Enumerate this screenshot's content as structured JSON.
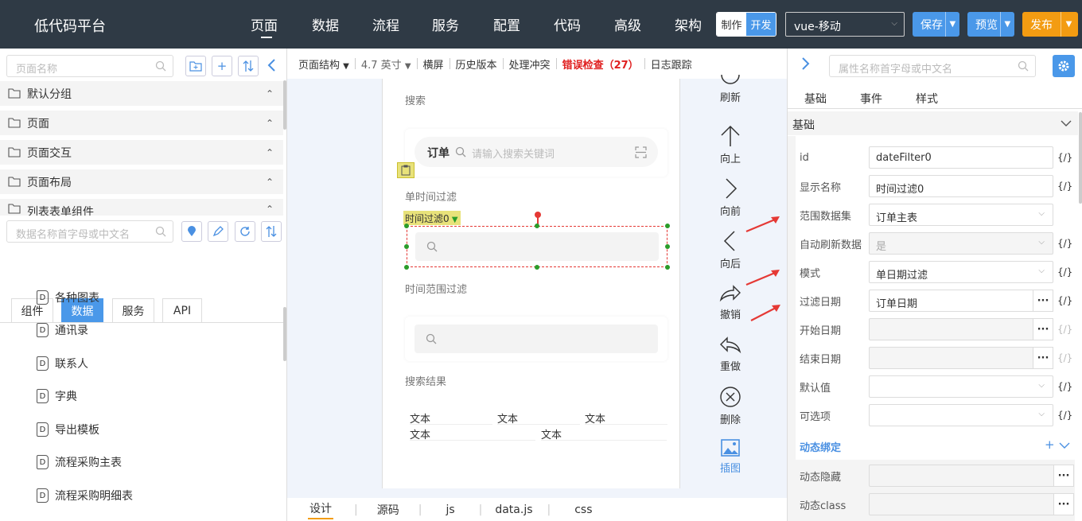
{
  "header": {
    "brand": "低代码平台",
    "nav": [
      "页面",
      "数据",
      "流程",
      "服务",
      "配置",
      "代码",
      "高级",
      "架构"
    ],
    "mode_make": "制作",
    "mode_dev": "开发",
    "platform": "vue-移动",
    "save": "保存",
    "preview": "预览",
    "publish": "发布"
  },
  "left": {
    "page_search_placeholder": "页面名称",
    "groups": [
      "默认分组",
      "页面",
      "页面交互",
      "页面布局",
      "列表表单组件"
    ],
    "data_search_placeholder": "数据名称首字母或中文名",
    "tabs": [
      "组件",
      "数据",
      "服务",
      "API"
    ],
    "datasources": [
      "各种图表",
      "通讯录",
      "联系人",
      "字典",
      "导出模板",
      "流程采购主表",
      "流程采购明细表"
    ]
  },
  "toolbar": {
    "structure": "页面结构",
    "size": "4.7 英寸",
    "landscape": "横屏",
    "history": "历史版本",
    "conflict": "处理冲突",
    "errors": "错误检查（27）",
    "log": "日志跟踪"
  },
  "canvas": {
    "search_title": "搜索",
    "order_label": "订单",
    "search_placeholder": "请输入搜索关键词",
    "single_filter_title": "单时间过滤",
    "selected_tag": "时间过滤0",
    "range_filter_title": "时间范围过滤",
    "result_title": "搜索结果",
    "text_cell": "文本"
  },
  "tools": [
    "刷新",
    "向上",
    "向前",
    "向后",
    "撤销",
    "重做",
    "删除",
    "插图"
  ],
  "bottom_tabs": [
    "设计",
    "源码",
    "js",
    "data.js",
    "css"
  ],
  "right": {
    "search_placeholder": "属性名称首字母或中文名",
    "tabs": [
      "基础",
      "事件",
      "样式"
    ],
    "section_basic": "基础",
    "id_label": "id",
    "id_value": "dateFilter0",
    "name_label": "显示名称",
    "name_value": "时间过滤0",
    "dataset_label": "范围数据集",
    "dataset_value": "订单主表",
    "autorefresh_label": "自动刷新数据",
    "autorefresh_value": "是",
    "mode_label": "模式",
    "mode_value": "单日期过滤",
    "filterdate_label": "过滤日期",
    "filterdate_value": "订单日期",
    "start_label": "开始日期",
    "end_label": "结束日期",
    "default_label": "默认值",
    "options_label": "可选项",
    "dynamic_title": "动态绑定",
    "dyn_hide_label": "动态隐藏",
    "dyn_class_label": "动态class",
    "curly": "{/}"
  }
}
